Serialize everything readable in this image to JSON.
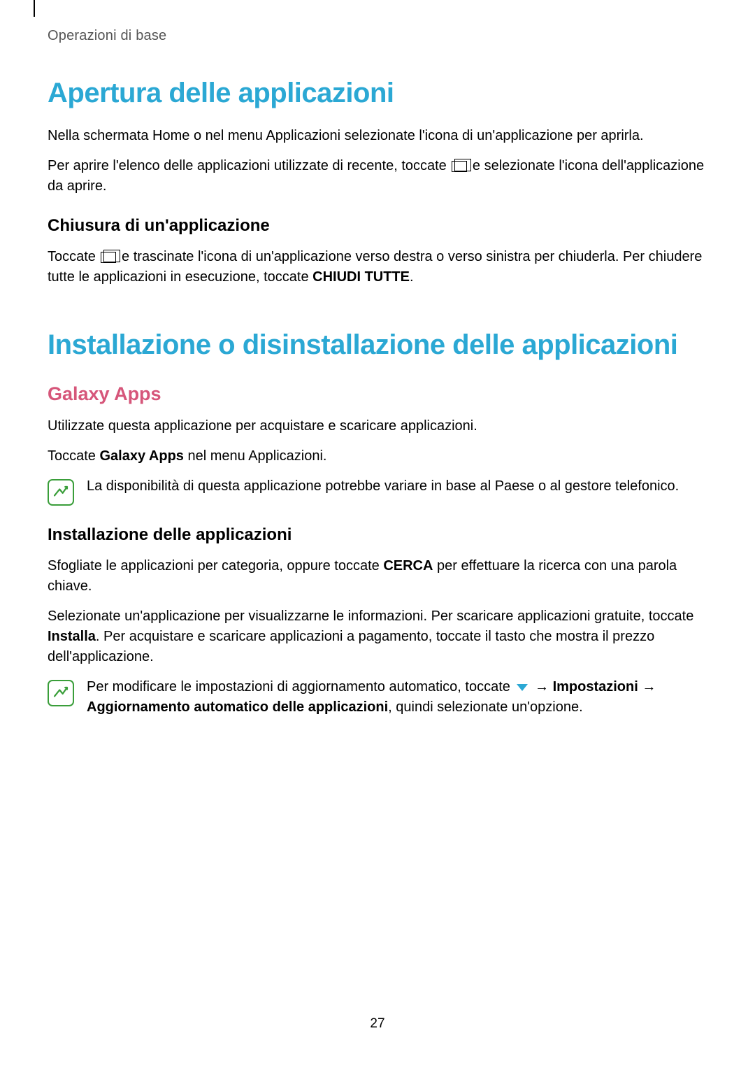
{
  "header": {
    "breadcrumb": "Operazioni di base"
  },
  "section1": {
    "title": "Apertura delle applicazioni",
    "p1": "Nella schermata Home o nel menu Applicazioni selezionate l'icona di un'applicazione per aprirla.",
    "p2a": "Per aprire l'elenco delle applicazioni utilizzate di recente, toccate ",
    "p2b": " e selezionate l'icona dell'applicazione da aprire.",
    "sub1": {
      "title": "Chiusura di un'applicazione",
      "p1a": "Toccate ",
      "p1b": " e trascinate l'icona di un'applicazione verso destra o verso sinistra per chiuderla. Per chiudere tutte le applicazioni in esecuzione, toccate ",
      "p1_bold": "CHIUDI TUTTE",
      "p1c": "."
    }
  },
  "section2": {
    "title": "Installazione o disinstallazione delle applicazioni",
    "sub1": {
      "title": "Galaxy Apps",
      "p1": "Utilizzate questa applicazione per acquistare e scaricare applicazioni.",
      "p2a": "Toccate ",
      "p2_bold": "Galaxy Apps",
      "p2b": " nel menu Applicazioni.",
      "note1": "La disponibilità di questa applicazione potrebbe variare in base al Paese o al gestore telefonico."
    },
    "sub2": {
      "title": "Installazione delle applicazioni",
      "p1a": "Sfogliate le applicazioni per categoria, oppure toccate ",
      "p1_bold": "CERCA",
      "p1b": " per effettuare la ricerca con una parola chiave.",
      "p2a": "Selezionate un'applicazione per visualizzarne le informazioni. Per scaricare applicazioni gratuite, toccate ",
      "p2_bold": "Installa",
      "p2b": ". Per acquistare e scaricare applicazioni a pagamento, toccate il tasto che mostra il prezzo dell'applicazione.",
      "note2a": "Per modificare le impostazioni di aggiornamento automatico, toccate ",
      "note2_arrow1": " → ",
      "note2_bold1": "Impostazioni",
      "note2_arrow2": " → ",
      "note2_bold2": "Aggiornamento automatico delle applicazioni",
      "note2b": ", quindi selezionate un'opzione."
    }
  },
  "footer": {
    "page_number": "27"
  }
}
